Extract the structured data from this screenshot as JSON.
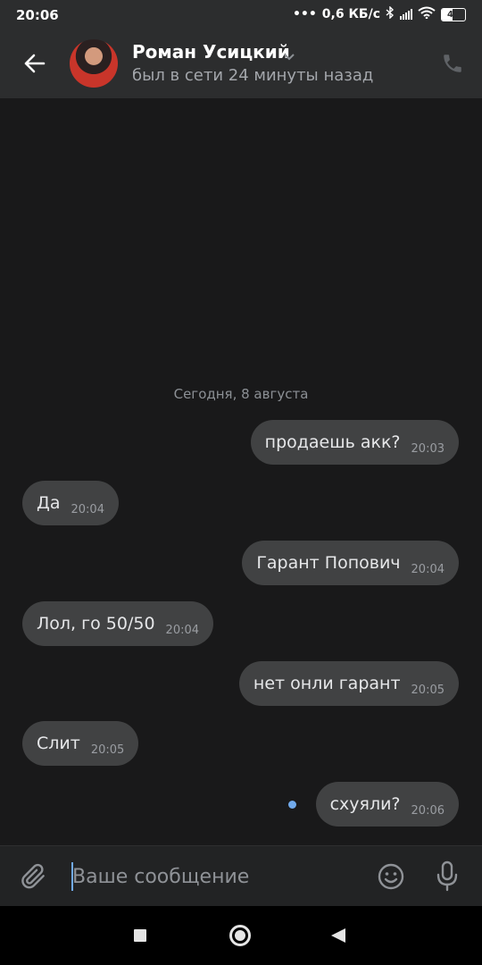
{
  "status_bar": {
    "time": "20:06",
    "network_speed": "0,6 КБ/с",
    "battery_level": "47",
    "icons": [
      "dots-icon",
      "bluetooth-icon",
      "signal-icon",
      "wifi-icon",
      "battery-icon"
    ]
  },
  "header": {
    "contact_name": "Роман Усицкий",
    "contact_status": "был в сети 24 минуты назад",
    "icons": [
      "back-arrow-icon",
      "chevron-down-icon",
      "phone-icon"
    ]
  },
  "chat": {
    "date_separator": "Сегодня, 8 августа",
    "messages": [
      {
        "direction": "outgoing",
        "text": "продаешь акк?",
        "time": "20:03"
      },
      {
        "direction": "incoming",
        "text": "Да",
        "time": "20:04"
      },
      {
        "direction": "outgoing",
        "text": "Гарант Попович",
        "time": "20:04"
      },
      {
        "direction": "incoming",
        "text": "Лол, го 50/50",
        "time": "20:04"
      },
      {
        "direction": "outgoing",
        "text": "нет онли гарант",
        "time": "20:05"
      },
      {
        "direction": "incoming",
        "text": "Слит",
        "time": "20:05"
      },
      {
        "direction": "outgoing",
        "text": "схуяли?",
        "time": "20:06",
        "unread": true
      }
    ]
  },
  "composer": {
    "placeholder": "Ваше сообщение",
    "icons": [
      "paperclip-icon",
      "emoji-icon",
      "microphone-icon"
    ]
  },
  "colors": {
    "background": "#19191a",
    "header": "#2c2d2e",
    "bubble": "#414243",
    "accent": "#71aaeb"
  }
}
